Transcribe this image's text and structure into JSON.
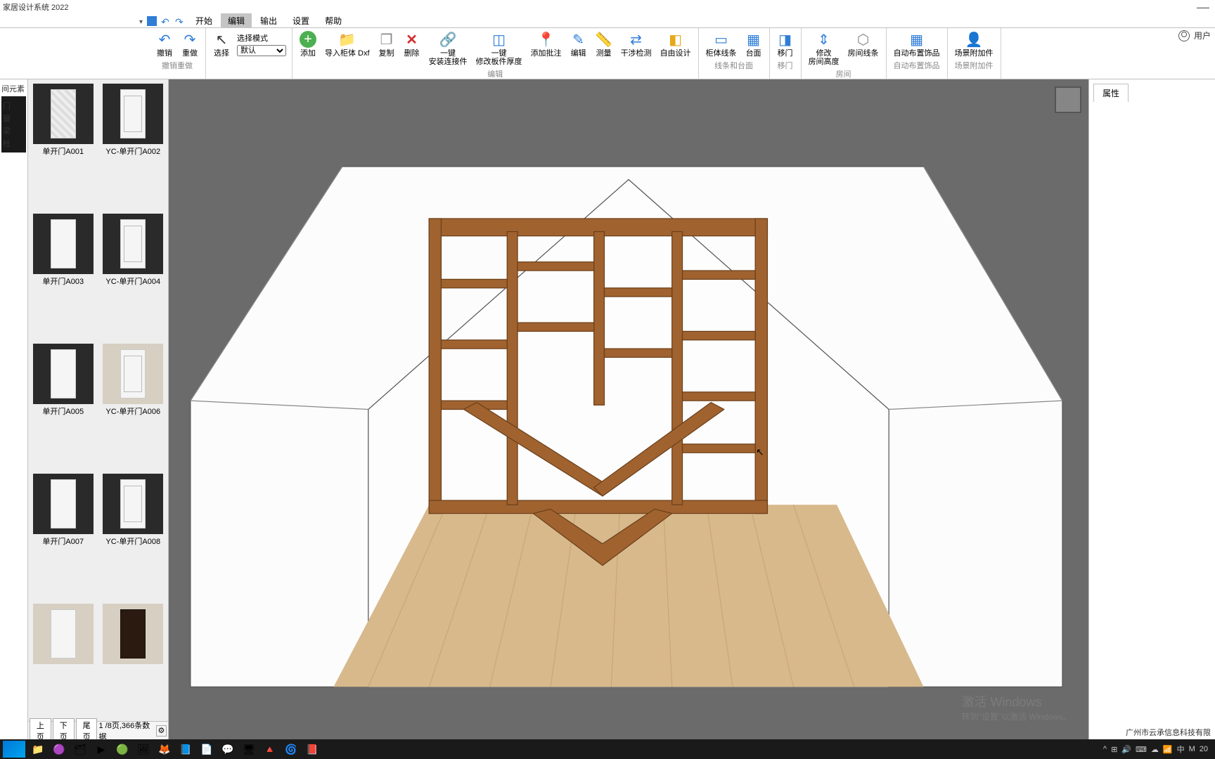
{
  "app": {
    "title": "家居设计系统 2022",
    "user_label": "用户"
  },
  "menu": {
    "items": [
      "开始",
      "编辑",
      "输出",
      "设置",
      "帮助"
    ],
    "active": "编辑"
  },
  "ribbon": {
    "groups": [
      {
        "label": "撤销重做",
        "buttons": [
          {
            "name": "undo-button",
            "icon": "↶",
            "cls": "ico-undo",
            "label": "撤销"
          },
          {
            "name": "redo-button",
            "icon": "↷",
            "cls": "ico-redo",
            "label": "重做"
          }
        ]
      },
      {
        "label": "",
        "selectMode": {
          "label": "选择模式",
          "value": "默认"
        },
        "buttons": [
          {
            "name": "select-button",
            "icon": "↖",
            "cls": "ico-arrow",
            "label": "选择"
          }
        ]
      },
      {
        "label": "编辑",
        "buttons": [
          {
            "name": "add-button",
            "icon": "+",
            "cls": "ico-plus",
            "label": "添加"
          },
          {
            "name": "import-dxf-button",
            "icon": "📁",
            "cls": "ico-import",
            "label": "导入柜体 Dxf"
          },
          {
            "name": "copy-button",
            "icon": "❐",
            "cls": "ico-copy",
            "label": "复制"
          },
          {
            "name": "delete-button",
            "icon": "✕",
            "cls": "ico-del",
            "label": "删除"
          },
          {
            "name": "install-connector-button",
            "icon": "🔗",
            "cls": "ico-link",
            "label": "一键\n安装连接件"
          },
          {
            "name": "modify-thickness-button",
            "icon": "◫",
            "cls": "ico-thick",
            "label": "一键\n修改板件厚度"
          },
          {
            "name": "add-batch-button",
            "icon": "📍",
            "cls": "ico-pin",
            "label": "添加批注"
          },
          {
            "name": "edit-button",
            "icon": "✎",
            "cls": "ico-edit",
            "label": "编辑"
          },
          {
            "name": "measure-button",
            "icon": "📏",
            "cls": "ico-ruler",
            "label": "测量"
          },
          {
            "name": "collision-check-button",
            "icon": "⇄",
            "cls": "ico-check",
            "label": "干涉检测"
          },
          {
            "name": "free-design-button",
            "icon": "◧",
            "cls": "ico-free",
            "label": "自由设计"
          }
        ]
      },
      {
        "label": "线条和台面",
        "buttons": [
          {
            "name": "cabinet-line-button",
            "icon": "▭",
            "cls": "ico-line",
            "label": "柜体线条"
          },
          {
            "name": "countertop-button",
            "icon": "▦",
            "cls": "ico-table",
            "label": "台面"
          }
        ]
      },
      {
        "label": "移门",
        "buttons": [
          {
            "name": "sliding-door-button",
            "icon": "◨",
            "cls": "ico-door",
            "label": "移门"
          }
        ]
      },
      {
        "label": "房间",
        "buttons": [
          {
            "name": "room-height-button",
            "icon": "⇕",
            "cls": "ico-height",
            "label": "修改\n房间高度"
          },
          {
            "name": "room-line-button",
            "icon": "⬡",
            "cls": "ico-room",
            "label": "房间线条"
          }
        ]
      },
      {
        "label": "自动布置饰品",
        "buttons": [
          {
            "name": "auto-decor-button",
            "icon": "▦",
            "cls": "ico-auto",
            "label": "自动布置饰品"
          }
        ]
      },
      {
        "label": "场景附加件",
        "buttons": [
          {
            "name": "scene-addon-button",
            "icon": "👤",
            "cls": "ico-attach",
            "label": "场景附加件"
          }
        ]
      }
    ]
  },
  "tree": {
    "items": [
      "间元素",
      "门",
      "窗",
      "梁",
      "柱"
    ]
  },
  "thumbs": {
    "items": [
      {
        "label": "单开门A001",
        "style": "quilted",
        "bg": "dark"
      },
      {
        "label": "YC-单开门A002",
        "style": "panel",
        "bg": "dark"
      },
      {
        "label": "单开门A003",
        "style": "plain",
        "bg": "dark"
      },
      {
        "label": "YC-单开门A004",
        "style": "panel",
        "bg": "dark"
      },
      {
        "label": "单开门A005",
        "style": "plain",
        "bg": "dark"
      },
      {
        "label": "YC-单开门A006",
        "style": "panel",
        "bg": "light"
      },
      {
        "label": "单开门A007",
        "style": "plain",
        "bg": "dark"
      },
      {
        "label": "YC-单开门A008",
        "style": "panel",
        "bg": "dark"
      },
      {
        "label": "",
        "style": "plain",
        "bg": "light"
      },
      {
        "label": "",
        "style": "dark",
        "bg": "light"
      }
    ],
    "pager": {
      "prev": "上页",
      "next": "下页",
      "last": "尾页",
      "info": "1 /8页,366条数据"
    }
  },
  "right": {
    "tab": "属性"
  },
  "watermark": {
    "line1": "激活 Windows",
    "line2": "转到\"设置\"以激活 Windows。"
  },
  "footer_company": "广州市云承信息科技有限",
  "taskbar": {
    "icons": [
      "📁",
      "🟣",
      "🗂",
      "▶",
      "🟢",
      "🖼",
      "🦊",
      "📘",
      "📄",
      "💬",
      "🖥",
      "🔺",
      "🌀",
      "📕"
    ],
    "tray": {
      "items": [
        "^",
        "⊞",
        "🔊",
        "⌨",
        "☁",
        "📶",
        "中",
        "M"
      ],
      "time": "20"
    }
  }
}
